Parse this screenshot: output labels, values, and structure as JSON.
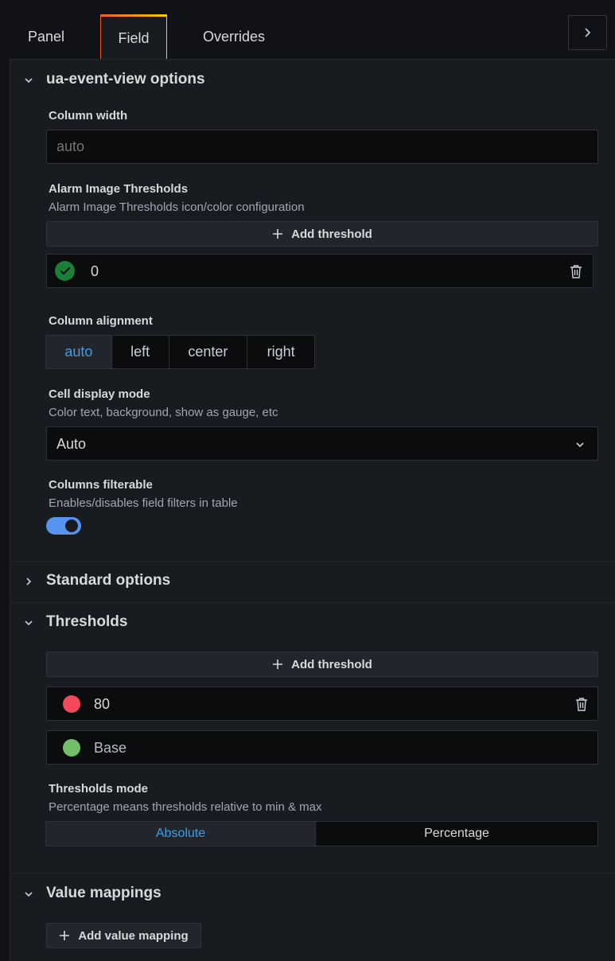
{
  "tabs": [
    {
      "label": "Panel"
    },
    {
      "label": "Field"
    },
    {
      "label": "Overrides"
    }
  ],
  "sections": {
    "options": {
      "title": "ua-event-view options",
      "column_width": {
        "label": "Column width",
        "placeholder": "auto"
      },
      "alarm_thresholds": {
        "label": "Alarm Image Thresholds",
        "description": "Alarm Image Thresholds icon/color configuration",
        "add_label": "Add threshold",
        "value": "0"
      },
      "alignment": {
        "label": "Column alignment",
        "options": [
          "auto",
          "left",
          "center",
          "right"
        ],
        "selected": "auto"
      },
      "cell_display": {
        "label": "Cell display mode",
        "description": "Color text, background, show as gauge, etc",
        "value": "Auto"
      },
      "filterable": {
        "label": "Columns filterable",
        "description": "Enables/disables field filters in table",
        "enabled": true
      }
    },
    "standard": {
      "title": "Standard options"
    },
    "thresholds": {
      "title": "Thresholds",
      "add_label": "Add threshold",
      "items": [
        {
          "value": "80",
          "color": "#f2495c"
        },
        {
          "value": "Base",
          "color": "#73bf69"
        }
      ],
      "mode": {
        "label": "Thresholds mode",
        "description": "Percentage means thresholds relative to min & max",
        "options": [
          "Absolute",
          "Percentage"
        ],
        "selected": "Absolute"
      }
    },
    "value_mappings": {
      "title": "Value mappings",
      "add_label": "Add value mapping"
    }
  },
  "colors": {
    "accent": "#3d9ee6",
    "success": "#1a7f37",
    "toggle": "#5794f2"
  }
}
